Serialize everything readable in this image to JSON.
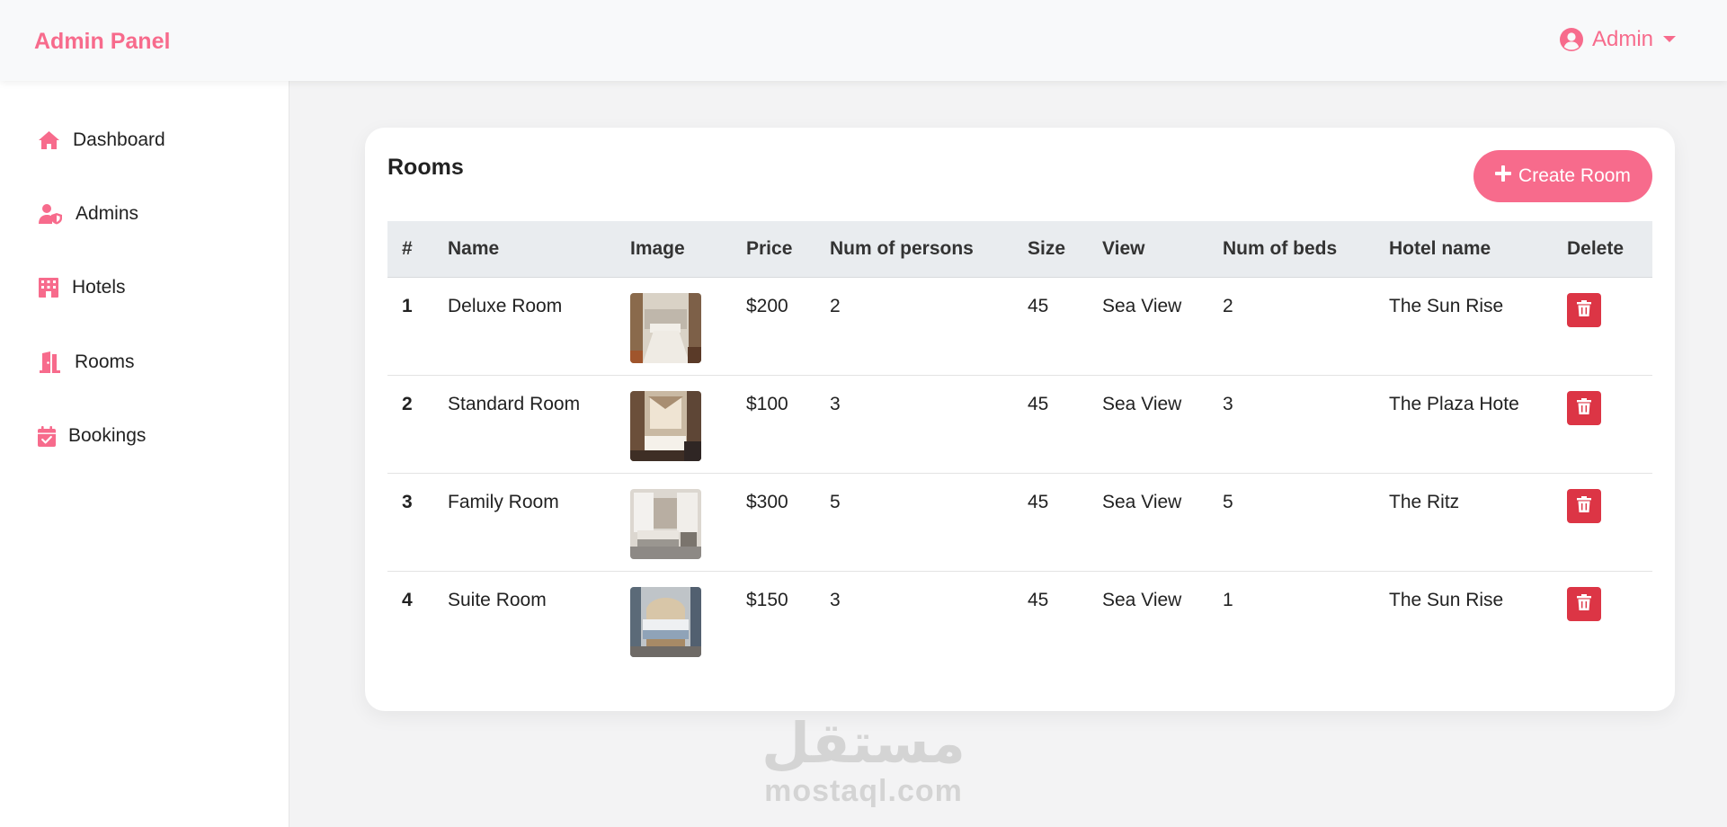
{
  "header": {
    "brand": "Admin Panel",
    "user_label": "Admin",
    "accent_color": "#f76b8c"
  },
  "sidebar": {
    "items": [
      {
        "label": "Dashboard",
        "icon": "home-icon"
      },
      {
        "label": "Admins",
        "icon": "user-shield-icon"
      },
      {
        "label": "Hotels",
        "icon": "hotel-icon"
      },
      {
        "label": "Rooms",
        "icon": "door-open-icon"
      },
      {
        "label": "Bookings",
        "icon": "calendar-check-icon"
      }
    ]
  },
  "rooms": {
    "title": "Rooms",
    "create_label": "Create Room",
    "columns": [
      "#",
      "Name",
      "Image",
      "Price",
      "Num of persons",
      "Size",
      "View",
      "Num of beds",
      "Hotel name",
      "Delete"
    ],
    "rows": [
      {
        "id": "1",
        "name": "Deluxe Room",
        "price": "$200",
        "persons": "2",
        "size": "45",
        "view": "Sea View",
        "beds": "2",
        "hotel": "The Sun Rise"
      },
      {
        "id": "2",
        "name": "Standard Room",
        "price": "$100",
        "persons": "3",
        "size": "45",
        "view": "Sea View",
        "beds": "3",
        "hotel": "The Plaza Hote"
      },
      {
        "id": "3",
        "name": "Family Room",
        "price": "$300",
        "persons": "5",
        "size": "45",
        "view": "Sea View",
        "beds": "5",
        "hotel": "The Ritz"
      },
      {
        "id": "4",
        "name": "Suite Room",
        "price": "$150",
        "persons": "3",
        "size": "45",
        "view": "Sea View",
        "beds": "1",
        "hotel": "The Sun Rise"
      }
    ],
    "delete_color": "#dc3545"
  },
  "watermark": {
    "arabic": "مستقل",
    "latin": "mostaql.com"
  }
}
